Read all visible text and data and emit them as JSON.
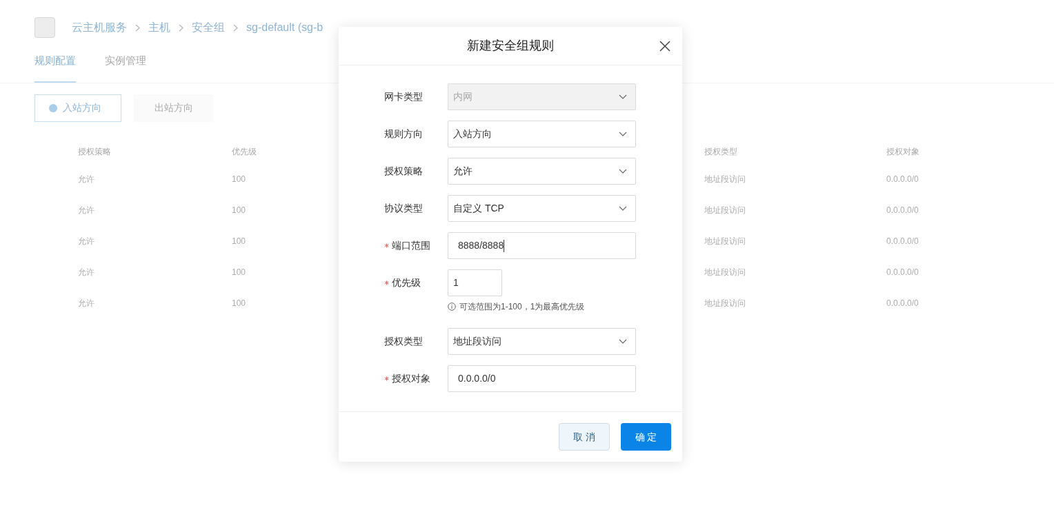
{
  "breadcrumb": [
    "云主机服务",
    "主机",
    "安全组",
    "sg-default (sg-b"
  ],
  "tabs": [
    {
      "label": "规则配置",
      "selected": true
    },
    {
      "label": "实例管理",
      "selected": false
    }
  ],
  "direction": [
    {
      "label": "入站方向",
      "selected": true
    },
    {
      "label": "出站方向",
      "selected": false
    }
  ],
  "table": {
    "columns": [
      "授权策略",
      "优先级",
      "授权类型",
      "授权对象"
    ],
    "rows": [
      [
        "允许",
        "100",
        "地址段访问",
        "0.0.0.0/0"
      ],
      [
        "允许",
        "100",
        "地址段访问",
        "0.0.0.0/0"
      ],
      [
        "允许",
        "100",
        "地址段访问",
        "0.0.0.0/0"
      ],
      [
        "允许",
        "100",
        "地址段访问",
        "0.0.0.0/0"
      ],
      [
        "允许",
        "100",
        "地址段访问",
        "0.0.0.0/0"
      ]
    ]
  },
  "dialog": {
    "title": "新建安全组规则",
    "fields": [
      {
        "label": "网卡类型",
        "kind": "select",
        "value": "内网",
        "required": false,
        "disabled": true
      },
      {
        "label": "规则方向",
        "kind": "select",
        "value": "入站方向",
        "required": false,
        "disabled": false
      },
      {
        "label": "授权策略",
        "kind": "select",
        "value": "允许",
        "required": false,
        "disabled": false
      },
      {
        "label": "协议类型",
        "kind": "select",
        "value": "自定义 TCP",
        "required": false,
        "disabled": false
      },
      {
        "label": "端口范围",
        "kind": "input",
        "value": "8888/8888",
        "required": true,
        "disabled": false,
        "focused": true
      },
      {
        "label": "优先级",
        "kind": "small_input",
        "value": "1",
        "required": true,
        "disabled": false,
        "hint": "可选范围为1-100，1为最高优先级"
      },
      {
        "label": "授权类型",
        "kind": "select",
        "value": "地址段访问",
        "required": false,
        "disabled": false
      },
      {
        "label": "授权对象",
        "kind": "input",
        "value": "0.0.0.0/0",
        "required": true,
        "disabled": false
      }
    ],
    "buttons": [
      {
        "label": "取 消",
        "kind": "secondary"
      },
      {
        "label": "确 定",
        "kind": "primary"
      }
    ]
  }
}
